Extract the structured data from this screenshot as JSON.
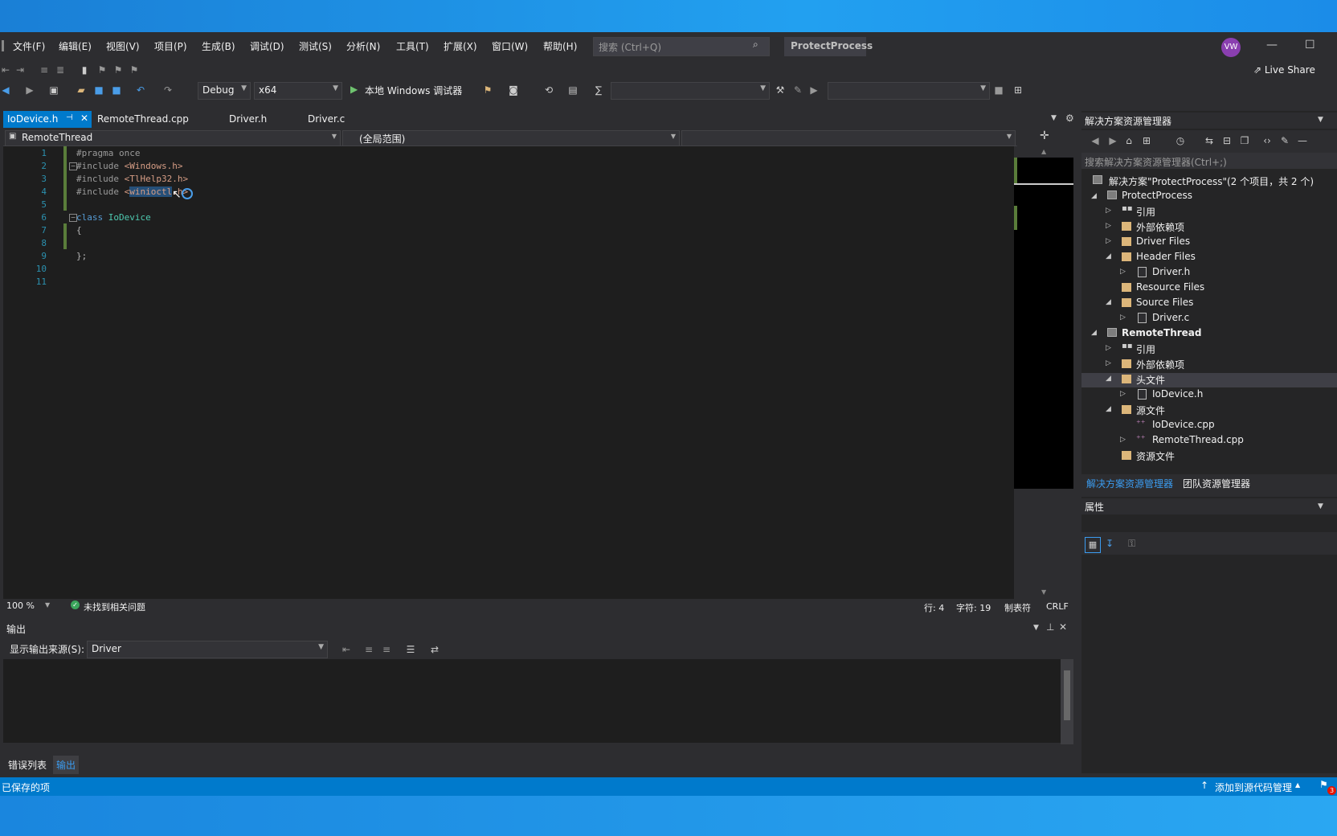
{
  "menu": [
    "文件(F)",
    "编辑(E)",
    "视图(V)",
    "项目(P)",
    "生成(B)",
    "调试(D)",
    "测试(S)",
    "分析(N)",
    "工具(T)",
    "扩展(X)",
    "窗口(W)",
    "帮助(H)"
  ],
  "search": {
    "placeholder": "搜索 (Ctrl+Q)"
  },
  "window_title": "ProtectProcess",
  "avatar": "VW",
  "live_share": "Live Share",
  "toolbar": {
    "config": "Debug",
    "platform": "x64",
    "run": "本地 Windows 调试器"
  },
  "tabs": [
    {
      "label": "IoDevice.h",
      "active": true
    },
    {
      "label": "RemoteThread.cpp",
      "active": false
    },
    {
      "label": "Driver.h",
      "active": false
    },
    {
      "label": "Driver.c",
      "active": false
    }
  ],
  "nav": {
    "project": "RemoteThread",
    "scope": "(全局范围)"
  },
  "code": {
    "lines": [
      "1",
      "2",
      "3",
      "4",
      "5",
      "6",
      "7",
      "8",
      "9",
      "10",
      "11"
    ],
    "l1": "#pragma once",
    "l2_kw": "#include ",
    "l2_inc": "<Windows.h>",
    "l3_kw": "#include ",
    "l3_inc": "<TlHelp32.h>",
    "l4_kw": "#include ",
    "l4_open": "<",
    "l4_sel": "winioctl",
    "l4_close": ".h>",
    "l6_kw": "class ",
    "l6_id": "IoDevice",
    "l7": "{",
    "l9": "};"
  },
  "editor_status": {
    "zoom": "100 %",
    "issues": "未找到相关问题",
    "line": "行: 4",
    "char": "字符: 19",
    "tab": "制表符",
    "eol": "CRLF"
  },
  "output": {
    "title": "输出",
    "source_label": "显示输出来源(S):",
    "source": "Driver"
  },
  "bottom_tabs": [
    "错误列表",
    "输出"
  ],
  "statusbar": {
    "left": "已保存的项",
    "right": "添加到源代码管理",
    "badge": "3"
  },
  "solution_explorer": {
    "title": "解决方案资源管理器",
    "search_placeholder": "搜索解决方案资源管理器(Ctrl+;)",
    "solution": "解决方案\"ProtectProcess\"(2 个项目，共 2 个)",
    "items": [
      {
        "label": "ProtectProcess",
        "type": "project"
      },
      {
        "label": "引用",
        "type": "ref"
      },
      {
        "label": "外部依赖项",
        "type": "folder"
      },
      {
        "label": "Driver Files",
        "type": "folder"
      },
      {
        "label": "Header Files",
        "type": "folder"
      },
      {
        "label": "Driver.h",
        "type": "file"
      },
      {
        "label": "Resource Files",
        "type": "folder"
      },
      {
        "label": "Source Files",
        "type": "folder"
      },
      {
        "label": "Driver.c",
        "type": "file"
      },
      {
        "label": "RemoteThread",
        "type": "project"
      },
      {
        "label": "引用",
        "type": "ref"
      },
      {
        "label": "外部依赖项",
        "type": "folder"
      },
      {
        "label": "头文件",
        "type": "folder"
      },
      {
        "label": "IoDevice.h",
        "type": "file"
      },
      {
        "label": "源文件",
        "type": "folder"
      },
      {
        "label": "IoDevice.cpp",
        "type": "cpp"
      },
      {
        "label": "RemoteThread.cpp",
        "type": "cpp"
      },
      {
        "label": "资源文件",
        "type": "folder"
      }
    ],
    "tabs": [
      "解决方案资源管理器",
      "团队资源管理器"
    ]
  },
  "properties": {
    "title": "属性"
  }
}
